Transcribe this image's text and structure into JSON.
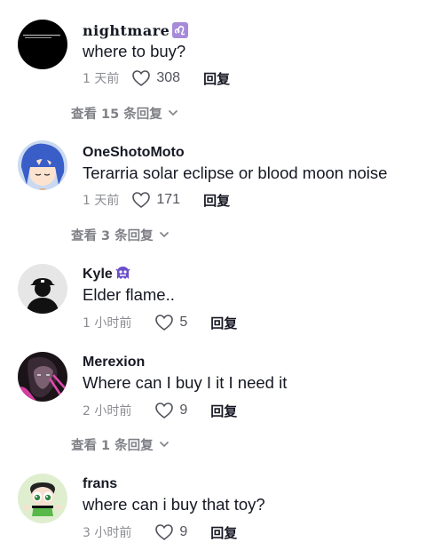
{
  "ui": {
    "reply_label": "回复",
    "accent_color": "#161823",
    "muted_color": "#8a8b91"
  },
  "comments": [
    {
      "username": "nightmare",
      "badge_icon": "leo-zodiac-icon",
      "text": "where to buy?",
      "time": "1 天前",
      "likes": "308",
      "view_replies": "查看 15 条回复"
    },
    {
      "username": "OneShotoMoto",
      "text": "Terarria solar eclipse or blood moon noise",
      "time": "1 天前",
      "likes": "171",
      "view_replies": "查看 3 条回复"
    },
    {
      "username": "Kyle",
      "badge_icon": "purple-monster-icon",
      "text": "Elder flame..",
      "time": "1 小时前",
      "likes": "5"
    },
    {
      "username": "Merexion",
      "text": "Where can I buy I it I need it",
      "time": "2 小时前",
      "likes": "9",
      "view_replies": "查看 1 条回复"
    },
    {
      "username": "frans",
      "text": "where can i buy that toy?",
      "time": "3 小时前",
      "likes": "9"
    }
  ]
}
